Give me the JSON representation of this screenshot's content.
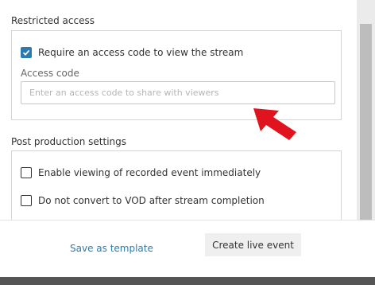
{
  "restricted_access": {
    "title": "Restricted access",
    "require_code_label": "Require an access code to view the stream",
    "require_code_checked": true,
    "access_code_label": "Access code",
    "access_code_value": "",
    "access_code_placeholder": "Enter an access code to share with viewers"
  },
  "post_production": {
    "title": "Post production settings",
    "options": [
      {
        "label": "Enable viewing of recorded event immediately",
        "checked": false
      },
      {
        "label": "Do not convert to VOD after stream completion",
        "checked": false
      }
    ]
  },
  "footer": {
    "save_template_label": "Save as template",
    "create_event_label": "Create live event"
  },
  "colors": {
    "accent": "#2b7bb0",
    "arrow": "#e0141e"
  },
  "icons": {
    "annotation_arrow": "red-arrow-icon",
    "checkmark": "checkmark-icon"
  }
}
